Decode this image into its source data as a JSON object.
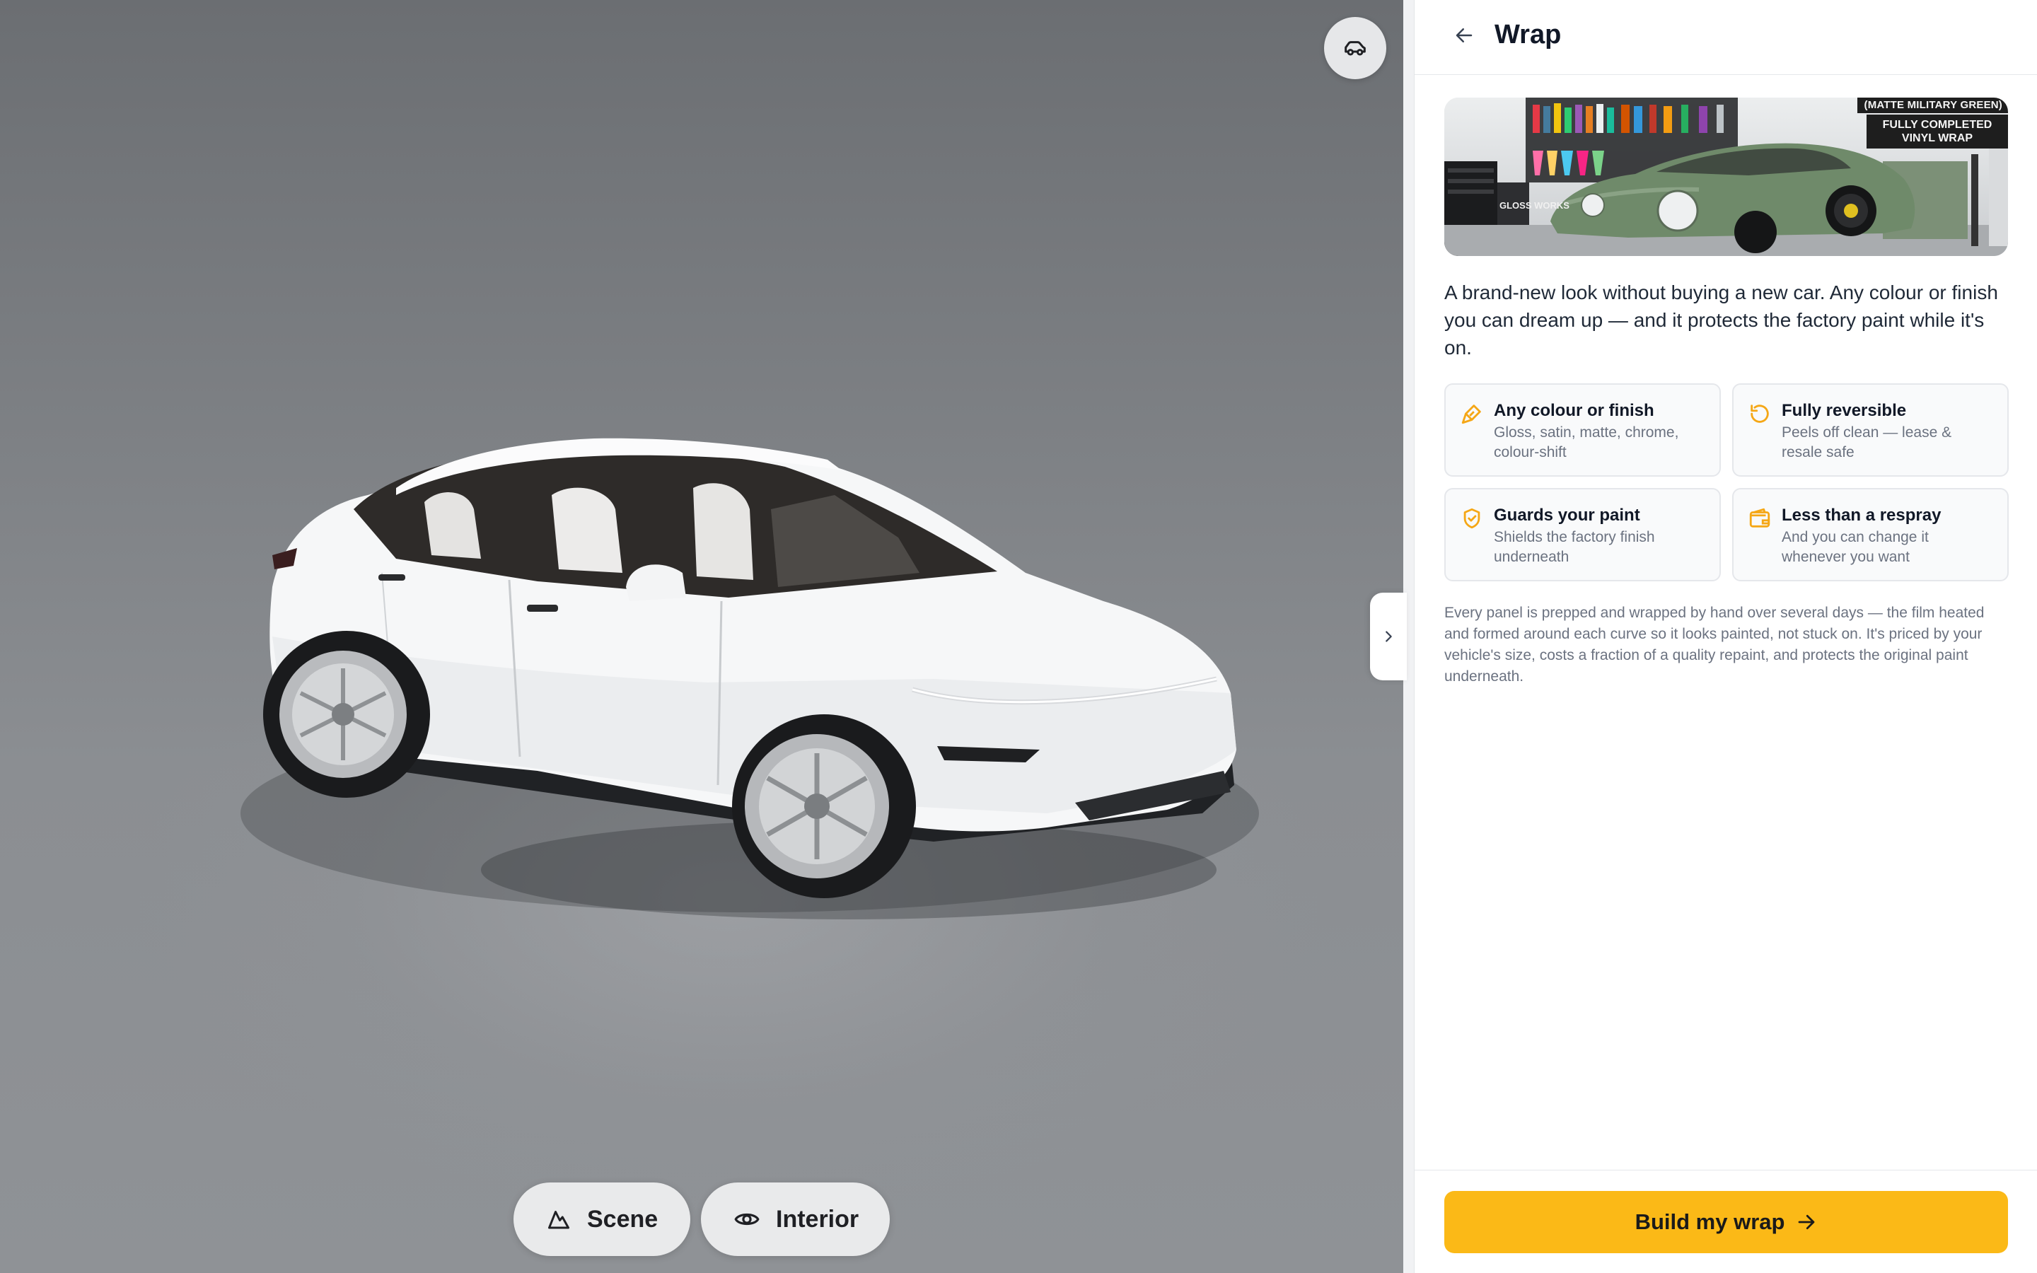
{
  "viewport": {
    "view_toggle_icon": "car-outline-icon",
    "buttons": {
      "scene_label": "Scene",
      "scene_icon": "mountain-icon",
      "interior_label": "Interior",
      "interior_icon": "eye-icon"
    },
    "collapse_icon": "chevron-right-icon"
  },
  "panel": {
    "back_icon": "arrow-left-icon",
    "title": "Wrap",
    "hero": {
      "tag_top": "(MATTE MILITARY GREEN)",
      "tag_main": "FULLY COMPLETED VINYL WRAP",
      "shop_badge": "GLOSS WORKS",
      "car_color": "#6f8a6a"
    },
    "intro": "A brand-new look without buying a new car. Any colour or finish you can dream up — and it protects the factory paint while it's on.",
    "features": [
      {
        "icon": "paintbrush-icon",
        "title": "Any colour or finish",
        "desc": "Gloss, satin, matte, chrome, colour-shift"
      },
      {
        "icon": "rotate-ccw-icon",
        "title": "Fully reversible",
        "desc": "Peels off clean — lease & resale safe"
      },
      {
        "icon": "shield-check-icon",
        "title": "Guards your paint",
        "desc": "Shields the factory finish underneath"
      },
      {
        "icon": "wallet-icon",
        "title": "Less than a respray",
        "desc": "And you can change it whenever you want"
      }
    ],
    "body": "Every panel is prepped and wrapped by hand over several days — the film heated and formed around each curve so it looks painted, not stuck on. It's priced by your vehicle's size, costs a fraction of a quality repaint, and protects the original paint underneath.",
    "cta_label": "Build my wrap",
    "cta_icon": "arrow-right-icon"
  },
  "colors": {
    "accent": "#fbb917",
    "icon_accent": "#f5a716",
    "viewport_bg": "#7e8185"
  }
}
